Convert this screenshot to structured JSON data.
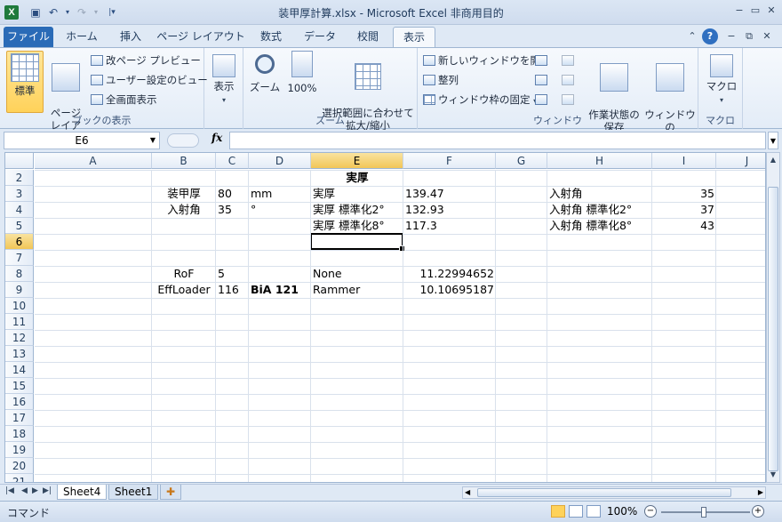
{
  "window": {
    "title": "装甲厚計算.xlsx - Microsoft Excel 非商用目的",
    "app_icon": "X",
    "min": "−",
    "max": "▭",
    "close": "✕"
  },
  "ribbon_tabs": [
    "ファイル",
    "ホーム",
    "挿入",
    "ページ レイアウト",
    "数式",
    "データ",
    "校閲",
    "表示"
  ],
  "active_tab": "表示",
  "ribbon": {
    "workbook_views": {
      "label": "ブックの表示",
      "normal": "標準",
      "page_layout": "ページ\nレイアウト",
      "page_break_preview": "改ページ プレビュー",
      "custom_views": "ユーザー設定のビュー",
      "full_screen": "全画面表示"
    },
    "show": {
      "label": "表示"
    },
    "zoom": {
      "label": "ズーム",
      "zoom": "ズーム",
      "hundred": "100%",
      "zoom_to_selection": "選択範囲に合わせて\n拡大/縮小"
    },
    "window": {
      "label": "ウィンドウ",
      "new_window": "新しいウィンドウを開く",
      "arrange": "整列",
      "freeze": "ウィンドウ枠の固定",
      "save_workspace": "作業状態の\n保存",
      "switch_windows": "ウィンドウの\n切り替え"
    },
    "macros": {
      "label": "マクロ",
      "macros": "マクロ"
    }
  },
  "formula_bar": {
    "name_box": "E6",
    "fx": "fx",
    "formula": ""
  },
  "columns": [
    "A",
    "B",
    "C",
    "D",
    "E",
    "F",
    "G",
    "H",
    "I",
    "J"
  ],
  "rows": [
    "2",
    "3",
    "4",
    "5",
    "6",
    "7",
    "8",
    "9",
    "10",
    "11",
    "12",
    "13",
    "14",
    "15",
    "16",
    "17",
    "18",
    "19",
    "20",
    "21"
  ],
  "active_cell": "E6",
  "cells": {
    "E2": "実厚",
    "B3": "装甲厚",
    "C3": "80",
    "D3": "mm",
    "E3": "実厚",
    "F3": "139.47",
    "H3": "入射角",
    "I3": "35",
    "B4": "入射角",
    "C4": "35",
    "D4": "°",
    "E4": "実厚 標準化2°",
    "F4": "132.93",
    "H4": "入射角 標準化2°",
    "I4": "37",
    "E5": "実厚 標準化8°",
    "F5": "117.3",
    "H5": "入射角 標準化8°",
    "I5": "43",
    "B8": "RoF",
    "C8": "5",
    "E8": "None",
    "F8": "11.22994652",
    "B9": "EffLoader",
    "C9": "116",
    "D9": "BiA 121",
    "E9": "Rammer",
    "F9": "10.10695187"
  },
  "sheet_tabs": [
    "Sheet4",
    "Sheet1"
  ],
  "active_sheet": "Sheet4",
  "status": {
    "mode": "コマンド",
    "zoom": "100%"
  }
}
